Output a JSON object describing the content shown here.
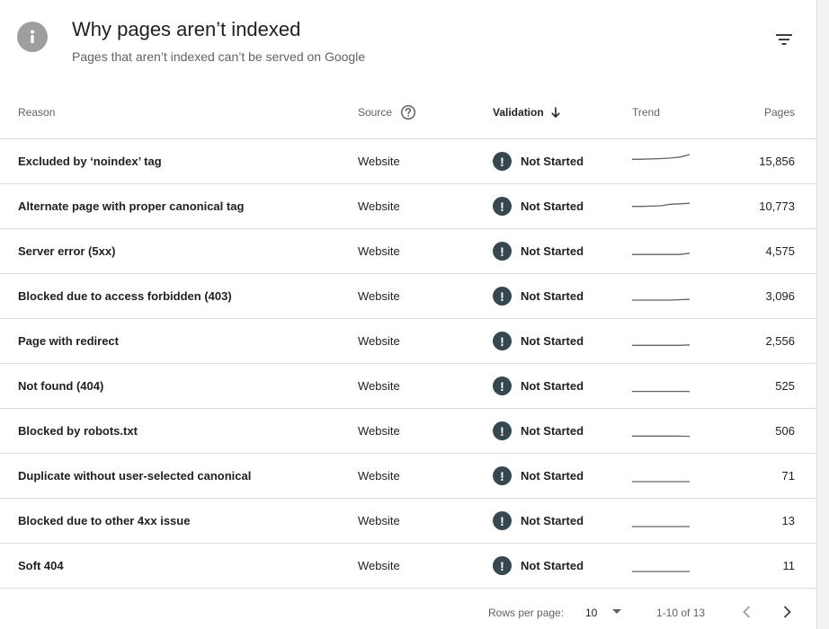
{
  "header": {
    "title": "Why pages aren’t indexed",
    "subtitle": "Pages that aren’t indexed can’t be served on Google",
    "icon": "info-icon",
    "filter_icon": "filter-icon"
  },
  "columns": {
    "reason": "Reason",
    "source": "Source",
    "validation": "Validation",
    "trend": "Trend",
    "pages": "Pages"
  },
  "rows": [
    {
      "reason": "Excluded by ‘noindex’ tag",
      "source": "Website",
      "validation": "Not Started",
      "pages": "15,856",
      "trend": [
        0.62,
        0.63,
        0.65,
        0.68,
        0.72,
        0.8,
        1.0
      ]
    },
    {
      "reason": "Alternate page with proper canonical tag",
      "source": "Website",
      "validation": "Not Started",
      "pages": "10,773",
      "trend": [
        0.45,
        0.45,
        0.47,
        0.5,
        0.62,
        0.66,
        0.7
      ]
    },
    {
      "reason": "Server error (5xx)",
      "source": "Website",
      "validation": "Not Started",
      "pages": "4,575",
      "trend": [
        0.2,
        0.2,
        0.2,
        0.2,
        0.2,
        0.2,
        0.3
      ]
    },
    {
      "reason": "Blocked due to access forbidden (403)",
      "source": "Website",
      "validation": "Not Started",
      "pages": "3,096",
      "trend": [
        0.14,
        0.14,
        0.14,
        0.14,
        0.14,
        0.18,
        0.2
      ]
    },
    {
      "reason": "Page with redirect",
      "source": "Website",
      "validation": "Not Started",
      "pages": "2,556",
      "trend": [
        0.12,
        0.12,
        0.12,
        0.12,
        0.12,
        0.12,
        0.16
      ]
    },
    {
      "reason": "Not found (404)",
      "source": "Website",
      "validation": "Not Started",
      "pages": "525",
      "trend": [
        0.03,
        0.03,
        0.03,
        0.03,
        0.03,
        0.03,
        0.03
      ]
    },
    {
      "reason": "Blocked by robots.txt",
      "source": "Website",
      "validation": "Not Started",
      "pages": "506",
      "trend": [
        0.05,
        0.05,
        0.05,
        0.05,
        0.05,
        0.04,
        0.03
      ]
    },
    {
      "reason": "Duplicate without user-selected canonical",
      "source": "Website",
      "validation": "Not Started",
      "pages": "71",
      "trend": [
        0.0,
        0.0,
        0.0,
        0.0,
        0.0,
        0.0,
        0.0
      ]
    },
    {
      "reason": "Blocked due to other 4xx issue",
      "source": "Website",
      "validation": "Not Started",
      "pages": "13",
      "trend": [
        0.0,
        0.0,
        0.0,
        0.0,
        0.0,
        0.0,
        0.0
      ]
    },
    {
      "reason": "Soft 404",
      "source": "Website",
      "validation": "Not Started",
      "pages": "11",
      "trend": [
        0.0,
        0.0,
        0.0,
        0.0,
        0.0,
        0.0,
        0.0
      ]
    }
  ],
  "footer": {
    "rows_per_page_label": "Rows per page:",
    "rows_per_page_value": "10",
    "range_label": "1-10 of 13"
  },
  "colors": {
    "status_icon": "#37474f",
    "trend_line": "#5f6368",
    "divider": "#dadce0"
  }
}
